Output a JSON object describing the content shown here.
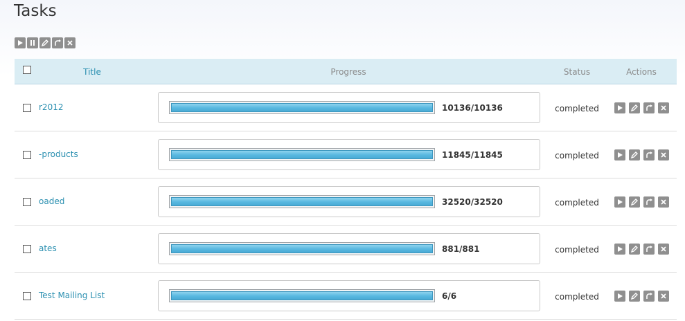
{
  "page": {
    "title": "Tasks"
  },
  "toolbar": {
    "buttons": [
      {
        "icon": "play-icon"
      },
      {
        "icon": "pause-icon"
      },
      {
        "icon": "edit-icon"
      },
      {
        "icon": "redo-icon"
      },
      {
        "icon": "close-icon"
      }
    ]
  },
  "table": {
    "headers": {
      "title": "Title",
      "progress": "Progress",
      "status": "Status",
      "actions": "Actions"
    },
    "rows": [
      {
        "title": "r2012",
        "progress_text": "10136/10136",
        "progress_fraction": 1.0,
        "status": "completed"
      },
      {
        "title": "-products",
        "progress_text": "11845/11845",
        "progress_fraction": 1.0,
        "status": "completed"
      },
      {
        "title": "oaded",
        "progress_text": "32520/32520",
        "progress_fraction": 1.0,
        "status": "completed"
      },
      {
        "title": "ates",
        "progress_text": "881/881",
        "progress_fraction": 1.0,
        "status": "completed"
      },
      {
        "title": "Test Mailing List",
        "progress_text": "6/6",
        "progress_fraction": 1.0,
        "status": "completed"
      }
    ]
  },
  "colors": {
    "header_bg": "#daedf4",
    "link": "#2a8fb0",
    "progress_fill": "#58b8e0",
    "icon_bg": "#8f8f8f"
  }
}
